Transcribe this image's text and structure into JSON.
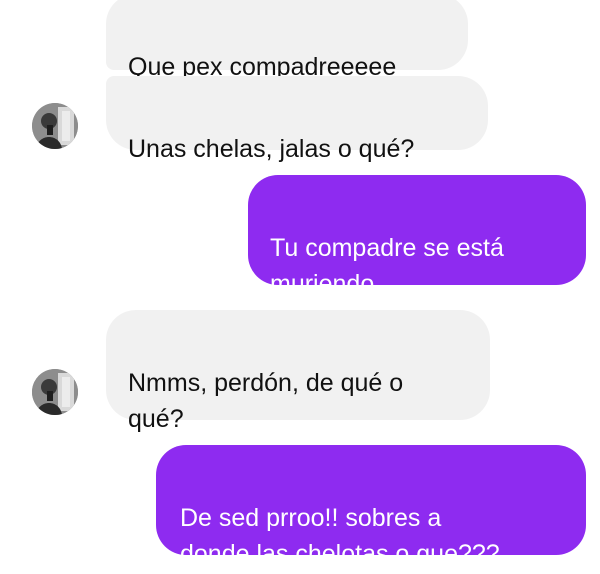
{
  "conversation": {
    "messages": [
      {
        "sender": "contact",
        "text": "Que pex compadreeeee"
      },
      {
        "sender": "contact",
        "text": "Unas chelas, jalas o qué?"
      },
      {
        "sender": "me",
        "text": "Tu compadre se está\nmuriendo..."
      },
      {
        "sender": "contact",
        "text": "Nmms, perdón, de qué o\nqué?"
      },
      {
        "sender": "me",
        "text": "De sed prroo!! sobres a\ndonde las chelotas o que???"
      }
    ]
  },
  "colors": {
    "incoming_bubble": "#f1f1f1",
    "outgoing_bubble": "#8e2bf0",
    "incoming_text": "#111111",
    "outgoing_text": "#ffffff"
  }
}
